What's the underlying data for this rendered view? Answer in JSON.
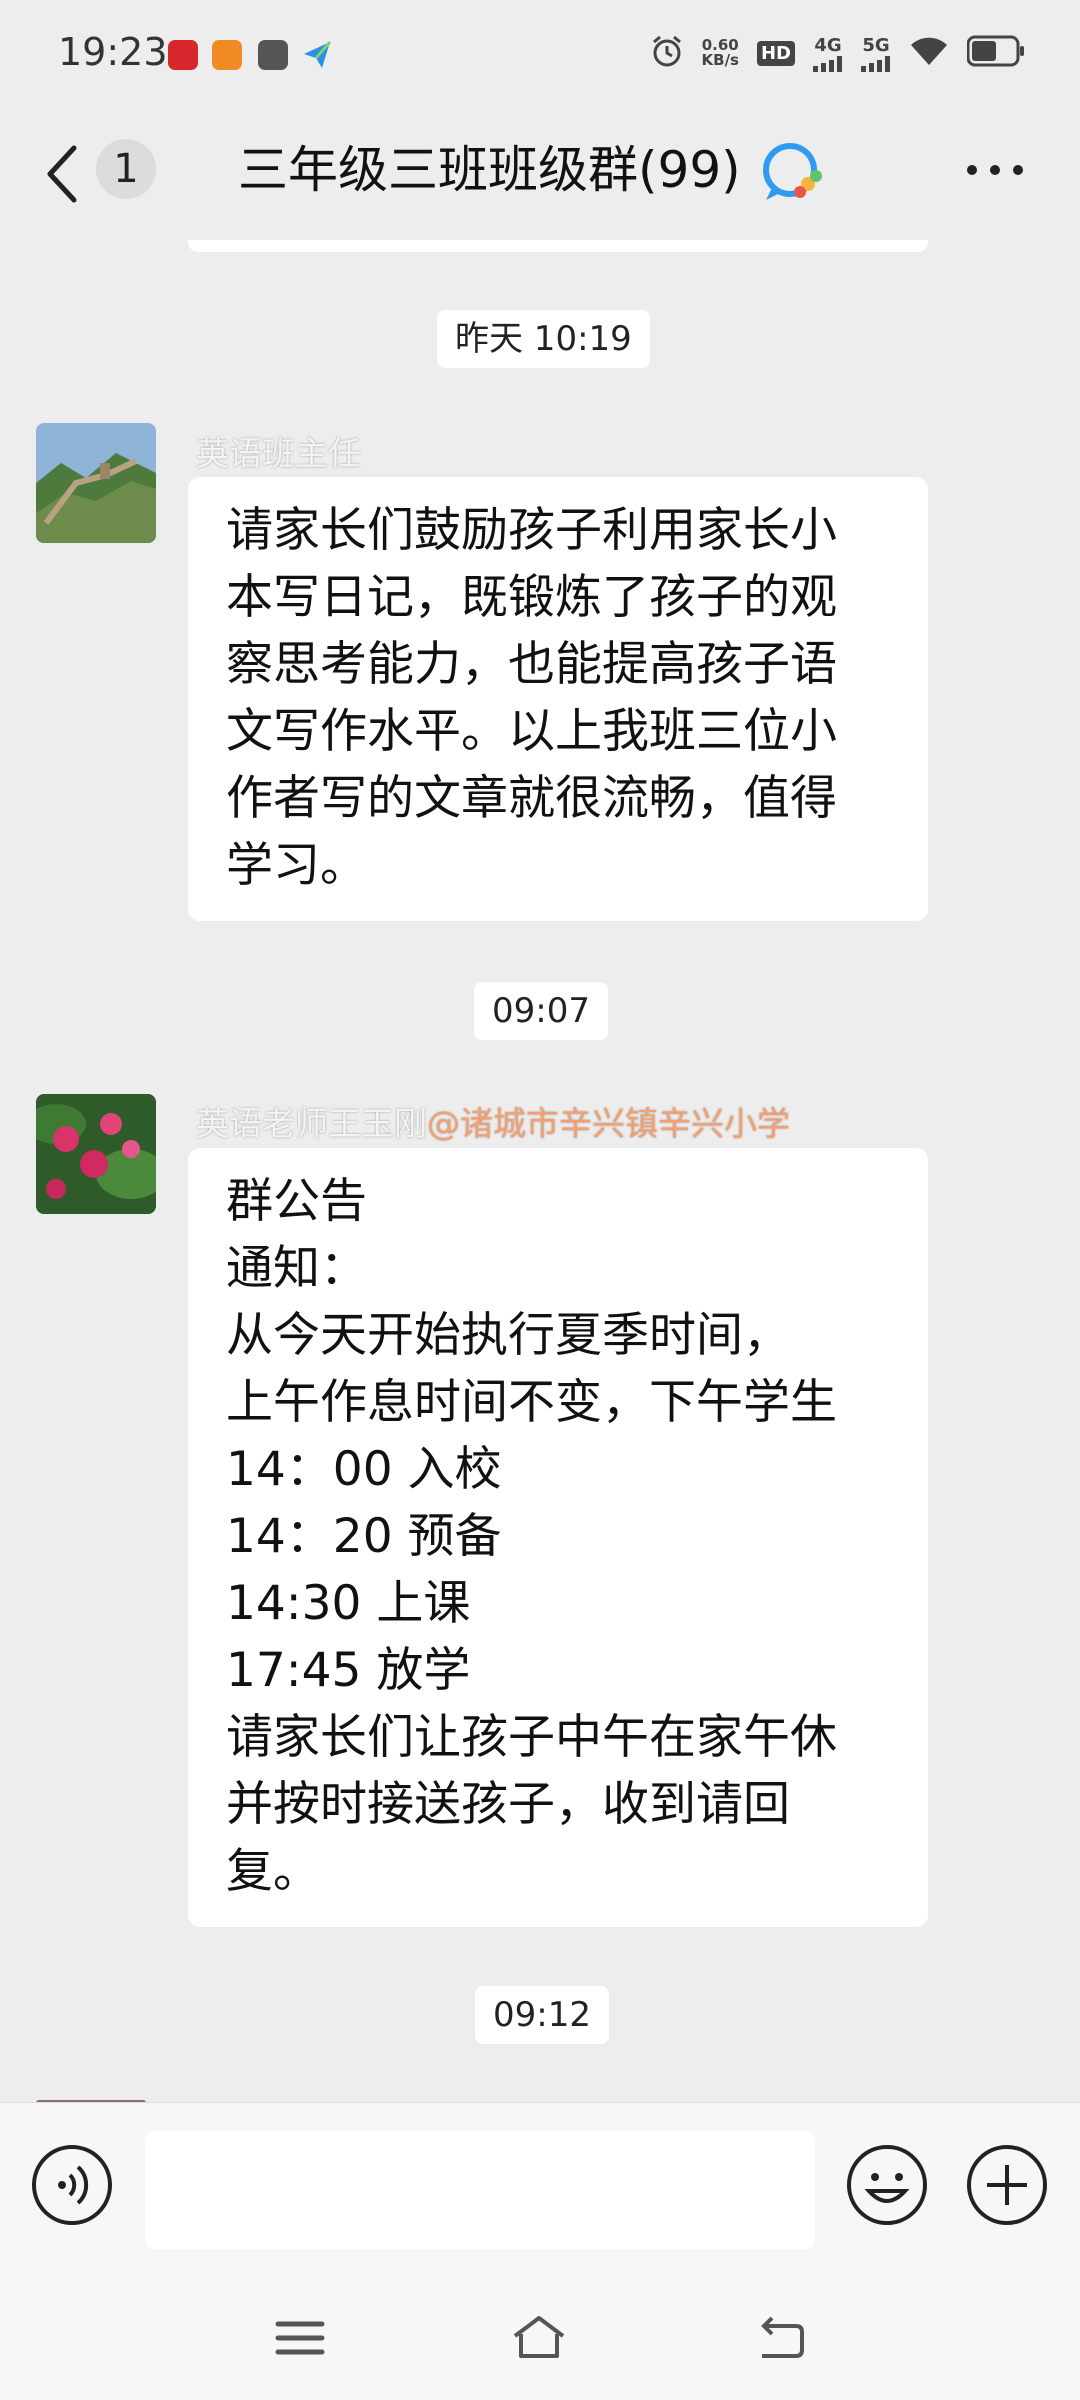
{
  "status_bar": {
    "time": "19:23",
    "net_speed_value": "0.60",
    "net_speed_unit": "KB/s",
    "hd_label": "HD",
    "signal_4g": "4G",
    "signal_5g": "5G",
    "icons": [
      "alarm-icon",
      "hd-icon",
      "4g-signal-icon",
      "5g-signal-icon",
      "wifi-icon",
      "battery-icon"
    ]
  },
  "header": {
    "unread_count": "1",
    "title": "三年级三班班级群(99)"
  },
  "chat": {
    "messages": [
      {
        "time": "昨天 10:19",
        "sender": "英语班主任",
        "sender_tag": "",
        "lines": [
          "请家长们鼓励孩子利用家长小",
          "本写日记，既锻炼了孩子的观",
          "察思考能力，也能提高孩子语",
          "文写作水平。以上我班三位小",
          "作者写的文章就很流畅，值得",
          "学习。"
        ]
      },
      {
        "time": "09:07",
        "sender": "英语老师王玉刚",
        "sender_tag": "@诸城市辛兴镇辛兴小学",
        "lines": [
          "群公告",
          "通知：",
          "从今天开始执行夏季时间，",
          "上午作息时间不变，下午学生",
          "14：00 入校",
          "14：20 预备",
          "14:30 上课",
          "17:45 放学",
          "请家长们让孩子中午在家午休",
          "并按时接送孩子，收到请回",
          "复。"
        ]
      },
      {
        "time": "09:12"
      }
    ]
  },
  "input_bar": {
    "text": "",
    "icons": [
      "voice-icon",
      "emoji-icon",
      "plus-icon"
    ]
  },
  "colors": {
    "background": "#ededed",
    "bubble": "#ffffff",
    "sender_tag": "#f2a070"
  }
}
